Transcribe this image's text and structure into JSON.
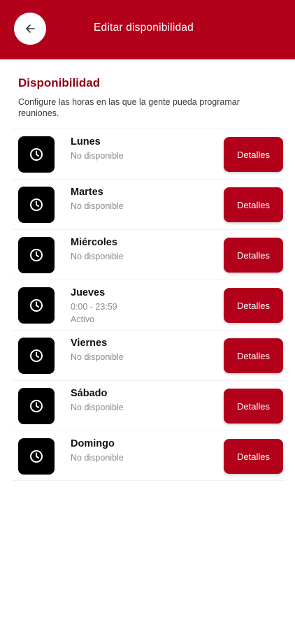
{
  "header": {
    "title": "Editar disponibilidad",
    "back_icon": "arrow-left-icon"
  },
  "section": {
    "title": "Disponibilidad",
    "description": "Configure las horas en las que la gente pueda programar reuniones."
  },
  "days": [
    {
      "name": "Lunes",
      "status": "No disponible",
      "extra": "",
      "button": "Detalles",
      "icon": "clock-icon"
    },
    {
      "name": "Martes",
      "status": "No disponible",
      "extra": "",
      "button": "Detalles",
      "icon": "clock-icon"
    },
    {
      "name": "Miércoles",
      "status": "No disponible",
      "extra": "",
      "button": "Detalles",
      "icon": "clock-icon"
    },
    {
      "name": "Jueves",
      "status": "0:00 - 23:59",
      "extra": "Activo",
      "button": "Detalles",
      "icon": "clock-icon"
    },
    {
      "name": "Viernes",
      "status": "No disponible",
      "extra": "",
      "button": "Detalles",
      "icon": "clock-icon"
    },
    {
      "name": "Sábado",
      "status": "No disponible",
      "extra": "",
      "button": "Detalles",
      "icon": "clock-icon"
    },
    {
      "name": "Domingo",
      "status": "No disponible",
      "extra": "",
      "button": "Detalles",
      "icon": "clock-icon"
    }
  ],
  "colors": {
    "brand": "#b3001b",
    "section_title": "#8c0015",
    "icon_tile": "#000000"
  }
}
